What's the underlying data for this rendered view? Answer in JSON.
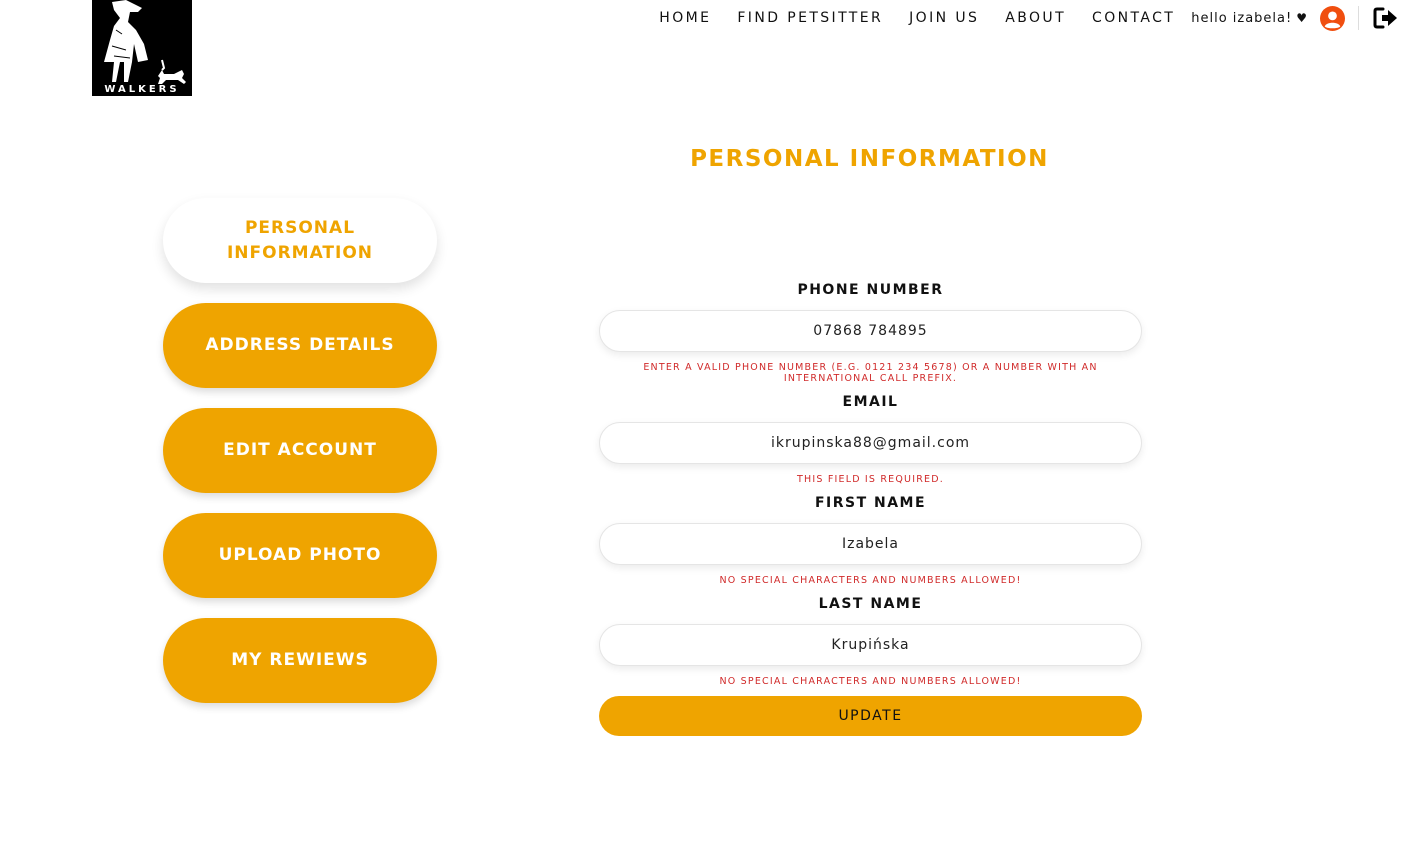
{
  "logo": {
    "text": "WALKERS"
  },
  "nav": {
    "items": [
      "HOME",
      "FIND PETSITTER",
      "JOIN US",
      "ABOUT",
      "CONTACT"
    ],
    "greeting": "hello izabela!",
    "heart": "♥"
  },
  "page_title": "PERSONAL INFORMATION",
  "sidebar": {
    "items": [
      {
        "label": "PERSONAL INFORMATION"
      },
      {
        "label": "ADDRESS DETAILS"
      },
      {
        "label": "EDIT ACCOUNT"
      },
      {
        "label": "UPLOAD PHOTO"
      },
      {
        "label": "MY REWIEWS"
      }
    ]
  },
  "form": {
    "phone": {
      "label": "PHONE NUMBER",
      "value": "07868 784895",
      "error": "ENTER A VALID PHONE NUMBER (E.G. 0121 234 5678) OR A NUMBER WITH AN INTERNATIONAL CALL PREFIX."
    },
    "email": {
      "label": "EMAIL",
      "value": "ikrupinska88@gmail.com",
      "error": "THIS FIELD IS REQUIRED."
    },
    "first_name": {
      "label": "FIRST NAME",
      "value": "Izabela",
      "error": "NO SPECIAL CHARACTERS AND NUMBERS ALLOWED!"
    },
    "last_name": {
      "label": "LAST NAME",
      "value": "Krupińska",
      "error": "NO SPECIAL CHARACTERS AND NUMBERS ALLOWED!"
    },
    "submit_label": "UPDATE"
  },
  "colors": {
    "accent": "#efa400",
    "error": "#d02a2a",
    "avatar": "#f04e0f"
  },
  "icons": {
    "avatar": "user-circle-icon",
    "logout": "sign-out-icon"
  }
}
